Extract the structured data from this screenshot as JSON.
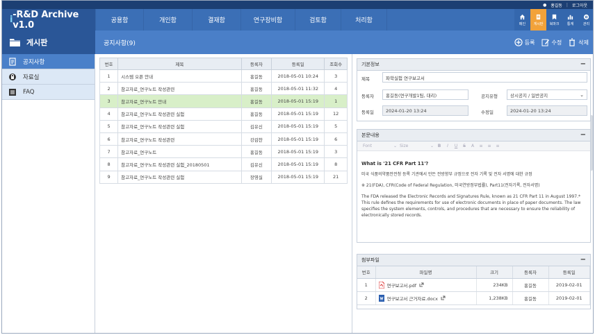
{
  "topbar": {
    "user": "홍길동",
    "logout": "로그아웃"
  },
  "logo": {
    "prefix": "i",
    "text": "-R&D Archive v1.0"
  },
  "menu": [
    "공용함",
    "개인함",
    "결재함",
    "연구장비함",
    "검토함",
    "처리함"
  ],
  "right_nav": [
    {
      "label": "메인",
      "icon": "home-icon"
    },
    {
      "label": "게시판",
      "icon": "board-icon",
      "active": true
    },
    {
      "label": "북마크",
      "icon": "bookmark-icon"
    },
    {
      "label": "통계",
      "icon": "chart-icon"
    },
    {
      "label": "관리",
      "icon": "gear-icon"
    }
  ],
  "section_title": "게시판",
  "page_title": "공지사항(9)",
  "actions": {
    "register": "등록",
    "edit": "수정",
    "delete": "삭제"
  },
  "sidebar": [
    {
      "label": "공지사항",
      "icon": "notice-icon",
      "active": true
    },
    {
      "label": "자료실",
      "icon": "lock-icon"
    },
    {
      "label": "FAQ",
      "icon": "list-icon"
    }
  ],
  "list": {
    "headers": [
      "번호",
      "제목",
      "등록자",
      "등록일",
      "조회수"
    ],
    "rows": [
      [
        "1",
        "시스템 오픈 안내",
        "홍길동",
        "2018-05-01 10:24",
        "3"
      ],
      [
        "2",
        "참고자료_연구노트 작성관련",
        "홍길동",
        "2018-05-01 11:32",
        "4"
      ],
      [
        "3",
        "참고자료_연구노트 안내",
        "홍길동",
        "2018-05-01 15:19",
        "1"
      ],
      [
        "4",
        "참고자료_연구노트 작성관련 실험",
        "홍길동",
        "2018-05-01 15:19",
        "12"
      ],
      [
        "5",
        "참고자료_연구노트 작성관련 실험",
        "김유신",
        "2018-05-01 15:19",
        "5"
      ],
      [
        "6",
        "참고자료_연구노트 작성관련",
        "강감찬",
        "2018-05-01 15:19",
        "6"
      ],
      [
        "7",
        "참고자료_연구노트",
        "홍길동",
        "2018-05-01 15:19",
        "3"
      ],
      [
        "8",
        "참고자료_연구노트 작성관련 실험_20180501",
        "김유신",
        "2018-05-01 15:19",
        "8"
      ],
      [
        "9",
        "참고자료_연구노트 작성관련 실험",
        "장영실",
        "2018-05-01 15:19",
        "21"
      ]
    ]
  },
  "basic_info": {
    "header": "기본정보",
    "title_label": "제목",
    "title_value": "파학실험 연구보고서",
    "author_label": "등록자",
    "author_value": "홍길동(연구개발1팀, 대리)",
    "type_label": "공지유형",
    "type_value": "상시공지 / 일반공지",
    "reg_label": "등록일",
    "reg_value": "2024-01-20 13:24",
    "mod_label": "수정일",
    "mod_value": "2024-01-20 13:24"
  },
  "content": {
    "header": "본문내용",
    "toolbar": {
      "font": "Font",
      "size": "Size"
    },
    "heading": "What is '21 CFR Part 11'?",
    "line1": "미국 식품의약품안전청 등록 기관에서 만든 전방향부 규정으로 전자 기록 및 전자 서명에 대한 규정",
    "line2": "※ 21(FDA), CFR(Code of Federal Regulation, 미국연방정부법률), Part11(전자기록, 전자서명)",
    "para": "The FDA released the Electronic Records and Signatures Rule, known as 21 CFR Part 11 in August 1997.* This rule defines the requirements for use of electronic documents in place of paper documents. The law specifies the system elements, controls, and procedures that are necessary to ensure the reliability of electronically stored records."
  },
  "attachments": {
    "header": "첨부파일",
    "headers": [
      "번호",
      "파일명",
      "크기",
      "등록자",
      "등록일"
    ],
    "rows": [
      {
        "no": "1",
        "name": "연구보고서.pdf",
        "type": "pdf",
        "size": "234KB",
        "author": "홍길동",
        "date": "2019-02-01"
      },
      {
        "no": "2",
        "name": "연구보고서 근거자료.docx",
        "type": "docx",
        "size": "1,238KB",
        "author": "홍길동",
        "date": "2019-02-01"
      }
    ]
  },
  "colors": {
    "nav": "#3b6fb6",
    "accent_active": "#f2a23a",
    "selected_row": "#d8efc8"
  }
}
